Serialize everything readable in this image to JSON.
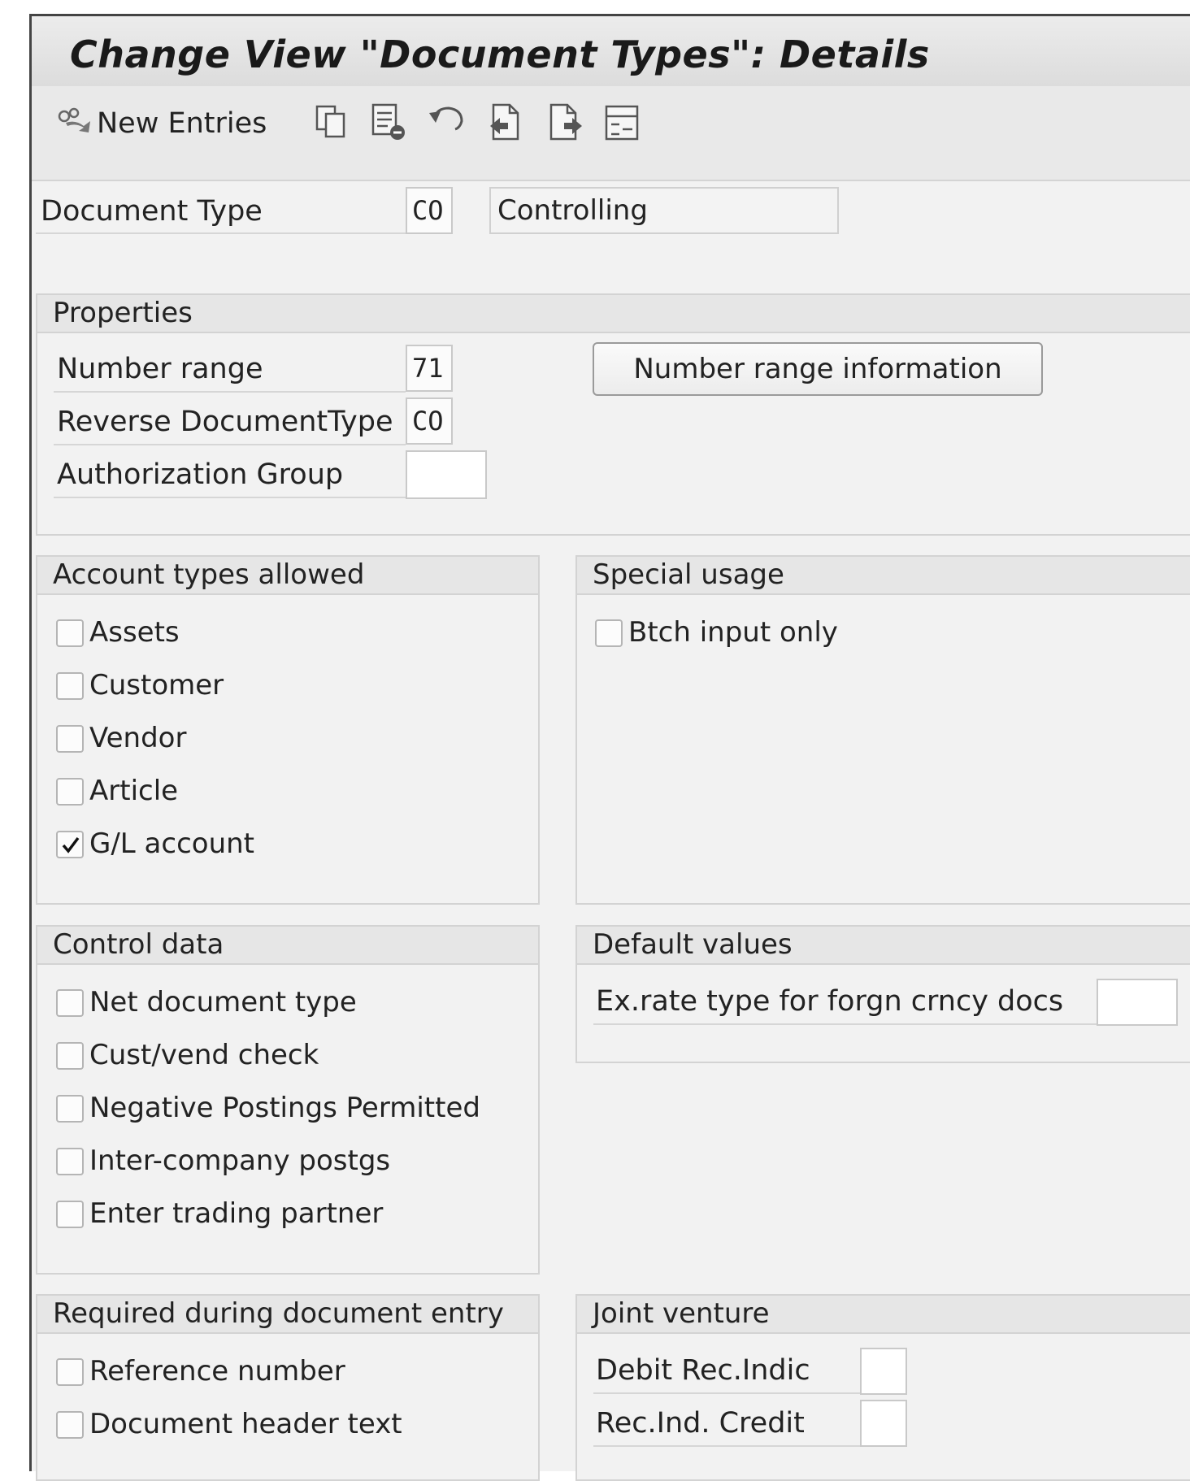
{
  "title": "Change View \"Document Types\": Details",
  "toolbar": {
    "icons": [
      "other-view-icon",
      "copy-icon",
      "delete-icon",
      "undo-icon",
      "previous-entry-icon",
      "next-entry-icon",
      "variable-list-icon"
    ],
    "new_entries_label": "New Entries"
  },
  "header": {
    "document_type_label": "Document Type",
    "document_type_value": "CO",
    "document_type_desc": "Controlling"
  },
  "properties": {
    "heading": "Properties",
    "number_range_label": "Number range",
    "number_range_value": "71",
    "reverse_doc_type_label": "Reverse DocumentType",
    "reverse_doc_type_value": "CO",
    "authorization_group_label": "Authorization Group",
    "authorization_group_value": "",
    "number_range_info_button": "Number range information"
  },
  "account_types": {
    "heading": "Account types allowed",
    "items": [
      {
        "label": "Assets",
        "checked": false
      },
      {
        "label": "Customer",
        "checked": false
      },
      {
        "label": "Vendor",
        "checked": false
      },
      {
        "label": "Article",
        "checked": false
      },
      {
        "label": "G/L account",
        "checked": true
      }
    ]
  },
  "special_usage": {
    "heading": "Special usage",
    "items": [
      {
        "label": "Btch input only",
        "checked": false
      }
    ]
  },
  "control_data": {
    "heading": "Control data",
    "items": [
      {
        "label": "Net document type",
        "checked": false
      },
      {
        "label": "Cust/vend check",
        "checked": false
      },
      {
        "label": "Negative Postings Permitted",
        "checked": false
      },
      {
        "label": "Inter-company postgs",
        "checked": false
      },
      {
        "label": "Enter trading partner",
        "checked": false
      }
    ]
  },
  "default_values": {
    "heading": "Default values",
    "exrate_label": "Ex.rate type for forgn crncy docs",
    "exrate_value": ""
  },
  "required_entry": {
    "heading": "Required during document entry",
    "items": [
      {
        "label": "Reference number",
        "checked": false
      },
      {
        "label": "Document header text",
        "checked": false
      }
    ]
  },
  "joint_venture": {
    "heading": "Joint venture",
    "debit_label": "Debit Rec.Indic",
    "debit_value": "",
    "credit_label": "Rec.Ind. Credit",
    "credit_value": ""
  }
}
